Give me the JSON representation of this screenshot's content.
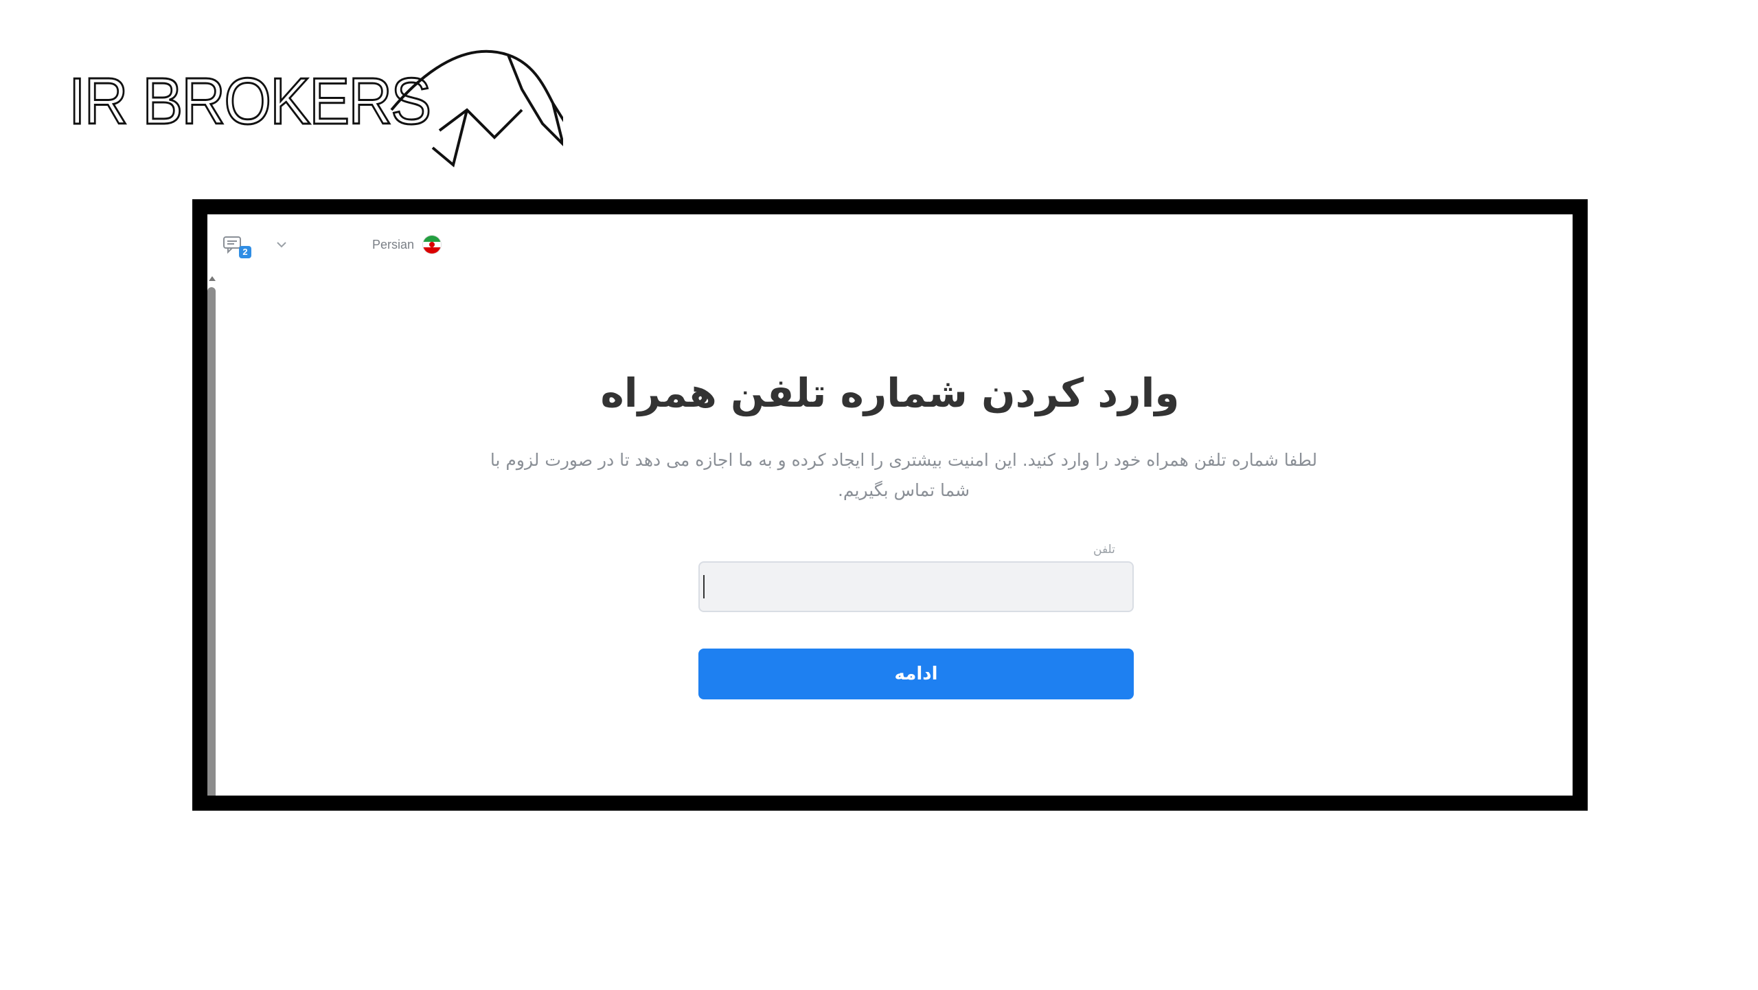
{
  "logo": {
    "text": "IR BROKERS"
  },
  "topbar": {
    "chat_badge_count": "2",
    "language_label": "Persian"
  },
  "main": {
    "title": "وارد کردن شماره تلفن همراه",
    "subtitle": "لطفا شماره تلفن همراه خود را وارد کنید. این امنیت بیشتری را ایجاد کرده و به ما اجازه می دهد تا در صورت لزوم با شما تماس بگیریم.",
    "phone_label": "تلفن",
    "phone_value": "",
    "continue_label": "ادامه"
  },
  "colors": {
    "accent": "#1e80f1",
    "title": "#333333",
    "subtitle": "#8a8f96",
    "badge": "#2f8de4",
    "frame": "#000000"
  },
  "icons": {
    "chat": "chat-bubbles-icon",
    "chevron": "chevron-down-icon",
    "flag": "iran-flag-icon"
  }
}
